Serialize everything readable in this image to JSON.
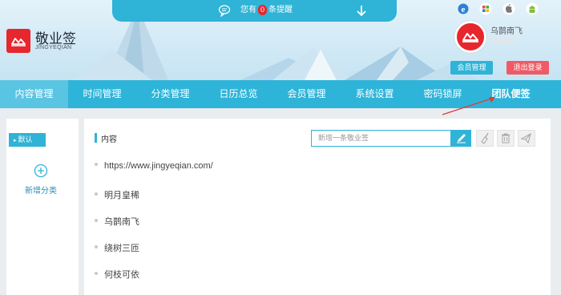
{
  "notice": {
    "prefix": "您有",
    "count": "0",
    "suffix": "条提醒"
  },
  "logo": {
    "name": "敬业签",
    "sub": "JINGYEQIAN"
  },
  "user": {
    "name": "乌鹊南飞",
    "member_button": "会员管理",
    "logout_button": "退出登录"
  },
  "top_icons": [
    "ie-icon",
    "windows-icon",
    "apple-icon",
    "android-icon"
  ],
  "nav": [
    {
      "label": "内容管理",
      "active": true
    },
    {
      "label": "时间管理"
    },
    {
      "label": "分类管理"
    },
    {
      "label": "日历总览"
    },
    {
      "label": "会员管理"
    },
    {
      "label": "系统设置"
    },
    {
      "label": "密码锁屏"
    },
    {
      "label": "团队便签"
    }
  ],
  "sidebar": {
    "default_label": "默认",
    "add_label": "新增分类"
  },
  "main": {
    "title": "内容",
    "input_placeholder": "新增一条敬业签",
    "items": [
      "https://www.jingyeqian.com/",
      "明月皇稀",
      "乌鹊南飞",
      "绕树三匝",
      "何枝可依"
    ]
  },
  "colors": {
    "accent": "#2fb3d6",
    "brand": "#e8262d",
    "logout": "#f05a66"
  }
}
